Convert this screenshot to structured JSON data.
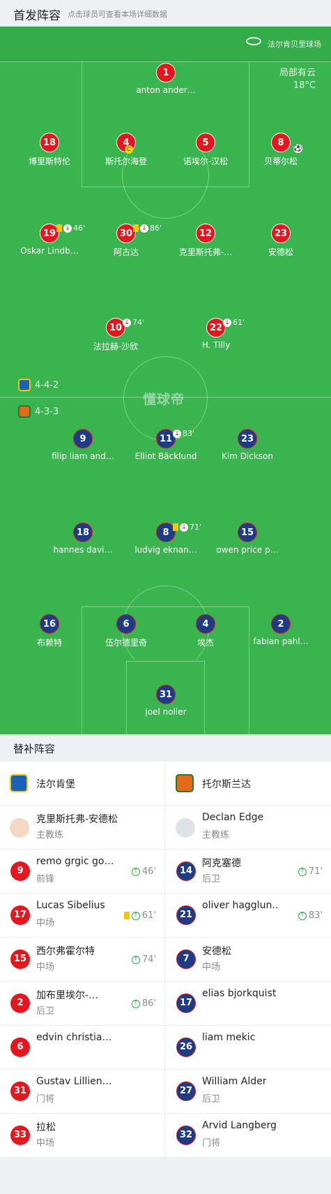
{
  "header": {
    "title": "首发阵容",
    "hint": "点击球员可查看本场详细数据"
  },
  "venue": "法尔肯贝里球场",
  "weather": {
    "desc": "局部有云",
    "temp": "18°C"
  },
  "watermark": "懂球帝",
  "home_formation": "4-4-2",
  "away_formation": "4-3-3",
  "colors": {
    "pitch": "#3ab44f",
    "home": "#e4171f",
    "away": "#1e3c86",
    "yellow_card": "#f4c50d",
    "sub_in": "#2fa94a"
  },
  "home_players": [
    {
      "num": "1",
      "name": "anton ander…"
    },
    {
      "num": "18",
      "name": "博里斯特伦"
    },
    {
      "num": "4",
      "name": "斯托尔海登",
      "captain": "C"
    },
    {
      "num": "5",
      "name": "诺埃尔-汉松"
    },
    {
      "num": "8",
      "name": "贝蒂尔松",
      "goal": "⚽"
    },
    {
      "num": "19",
      "name": "Oskar Lindb…",
      "event": "46'"
    },
    {
      "num": "30",
      "name": "阿古达",
      "event": "86'"
    },
    {
      "num": "12",
      "name": "克里斯托弗-…"
    },
    {
      "num": "23",
      "name": "安德松"
    },
    {
      "num": "10",
      "name": "法拉赫-沙欣",
      "event": "74'"
    },
    {
      "num": "22",
      "name": "H. Tilly",
      "event": "61'"
    }
  ],
  "away_players": [
    {
      "num": "9",
      "name": "filip liam and…"
    },
    {
      "num": "11",
      "name": "Elliot Bäcklund",
      "event": "83'"
    },
    {
      "num": "23",
      "name": "Kim Dickson"
    },
    {
      "num": "18",
      "name": "hannes davi…"
    },
    {
      "num": "8",
      "name": "ludvig eknan…",
      "event": "71'"
    },
    {
      "num": "15",
      "name": "owen price p…"
    },
    {
      "num": "16",
      "name": "布赖特"
    },
    {
      "num": "6",
      "name": "伍尔德里奇"
    },
    {
      "num": "4",
      "name": "埃杰"
    },
    {
      "num": "2",
      "name": "fabian pahl…"
    },
    {
      "num": "31",
      "name": "joel noller"
    }
  ],
  "subs_title": "替补阵容",
  "subs": {
    "home_team": "法尔肯堡",
    "away_team": "托尔斯兰达",
    "home_coach": {
      "name": "克里斯托弗-安德松",
      "role": "主教练"
    },
    "away_coach": {
      "name": "Declan Edge",
      "role": "主教练"
    },
    "home": [
      {
        "num": "9",
        "name": "remo grgic go…",
        "pos": "前锋",
        "min": "46'"
      },
      {
        "num": "17",
        "name": "Lucas Sibelius",
        "pos": "中场",
        "min": "61'",
        "card": "yellow"
      },
      {
        "num": "15",
        "name": "西尔弗霍尔特",
        "pos": "中场",
        "min": "74'"
      },
      {
        "num": "2",
        "name": "加布里埃尔-…",
        "pos": "后卫",
        "min": "86'"
      },
      {
        "num": "6",
        "name": "edvin christia…",
        "pos": "",
        "min": ""
      },
      {
        "num": "31",
        "name": "Gustav Lillien…",
        "pos": "门将",
        "min": ""
      },
      {
        "num": "33",
        "name": "拉松",
        "pos": "中场",
        "min": ""
      }
    ],
    "away": [
      {
        "num": "14",
        "name": "阿克塞德",
        "pos": "后卫",
        "min": "71'"
      },
      {
        "num": "21",
        "name": "oliver hagglun…",
        "pos": "",
        "min": "83'"
      },
      {
        "num": "7",
        "name": "安德松",
        "pos": "中场",
        "min": ""
      },
      {
        "num": "17",
        "name": "elias bjorkquist",
        "pos": "",
        "min": ""
      },
      {
        "num": "26",
        "name": "liam mekic",
        "pos": "",
        "min": ""
      },
      {
        "num": "27",
        "name": "William Alder",
        "pos": "后卫",
        "min": ""
      },
      {
        "num": "32",
        "name": "Arvid Langberg",
        "pos": "门将",
        "min": ""
      }
    ]
  }
}
